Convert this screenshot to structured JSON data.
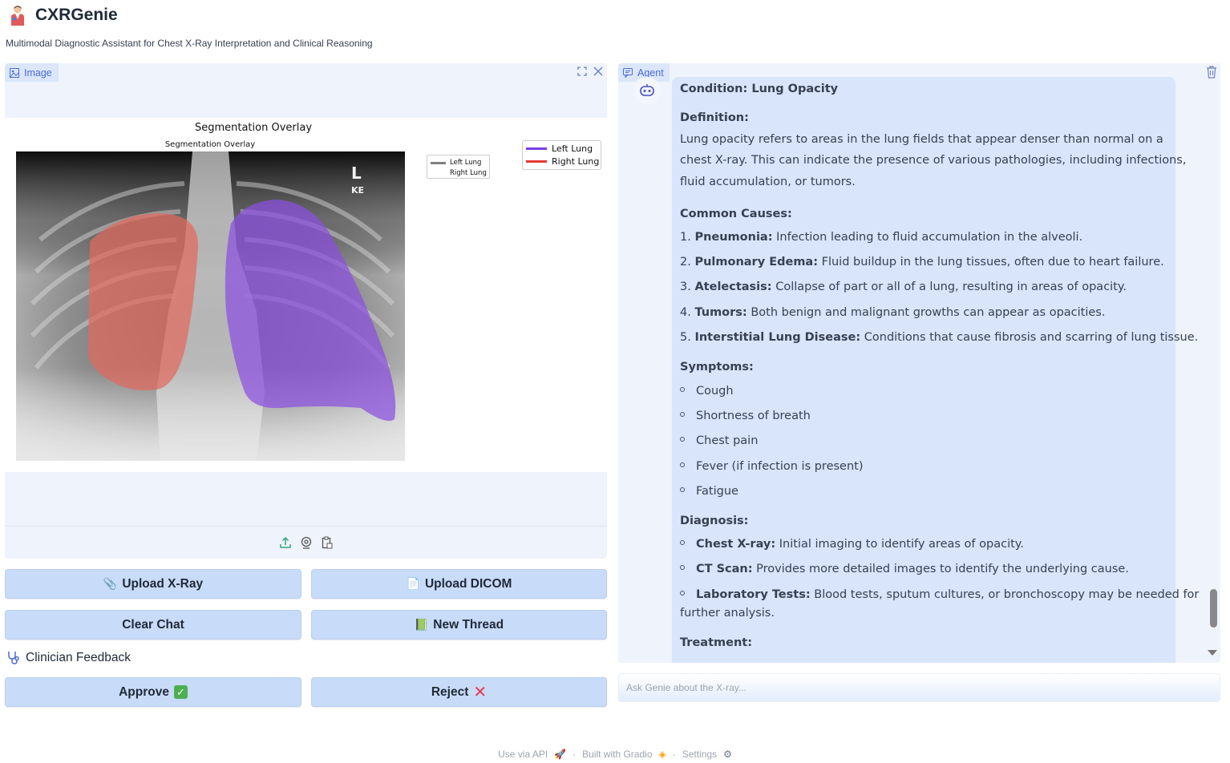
{
  "app": {
    "title": "CXRGenie",
    "subtitle": "Multimodal Diagnostic Assistant for Chest X-Ray Interpretation and Clinical Reasoning"
  },
  "image_panel": {
    "tag": "Image",
    "figure": {
      "suptitle": "Segmentation Overlay",
      "title": "Segmentation Overlay",
      "xray_markers": [
        "L",
        "KE"
      ],
      "legend_small": [
        "Left Lung",
        "Right Lung"
      ],
      "legend_big": [
        "Left Lung",
        "Right Lung"
      ],
      "colors": {
        "left_lung": "#7b3fe4",
        "right_lung": "#e53935",
        "small_legend_left": "#808080"
      }
    }
  },
  "buttons": {
    "upload_xray": "Upload X-Ray",
    "upload_dicom": "Upload DICOM",
    "clear_chat": "Clear Chat",
    "new_thread": "New Thread",
    "approve": "Approve",
    "reject": "Reject"
  },
  "feedback": {
    "label": "Clinician Feedback"
  },
  "chat": {
    "tag": "Agent",
    "condition_label": "Condition:",
    "condition_value": "Lung Opacity",
    "definition_label": "Definition:",
    "definition_lines": [
      "Lung opacity refers to areas in the lung fields that appear denser than normal on a",
      "chest X-ray. This can indicate the presence of various pathologies, including infections,",
      "fluid accumulation, or tumors."
    ],
    "causes_label": "Common Causes:",
    "causes": [
      {
        "num": "1.",
        "term": "Pneumonia:",
        "text": "Infection leading to fluid accumulation in the alveoli."
      },
      {
        "num": "2.",
        "term": "Pulmonary Edema:",
        "text": "Fluid buildup in the lung tissues, often due to heart failure."
      },
      {
        "num": "3.",
        "term": "Atelectasis:",
        "text": "Collapse of part or all of a lung, resulting in areas of opacity."
      },
      {
        "num": "4.",
        "term": "Tumors:",
        "text": "Both benign and malignant growths can appear as opacities."
      },
      {
        "num": "5.",
        "term": "Interstitial Lung Disease:",
        "text": "Conditions that cause fibrosis and scarring of lung tissue."
      }
    ],
    "symptoms_label": "Symptoms:",
    "symptoms": [
      "Cough",
      "Shortness of breath",
      "Chest pain",
      "Fever (if infection is present)",
      "Fatigue"
    ],
    "diagnosis_label": "Diagnosis:",
    "diagnosis": [
      {
        "term": "Chest X-ray:",
        "text": "Initial imaging to identify areas of opacity."
      },
      {
        "term": "CT Scan:",
        "text": "Provides more detailed images to identify the underlying cause."
      },
      {
        "term": "Laboratory Tests:",
        "text": "Blood tests, sputum cultures, or bronchoscopy may be needed for"
      }
    ],
    "diagnosis_continuation": "further analysis.",
    "treatment_label": "Treatment:",
    "input_placeholder": "Ask Genie about the X-ray..."
  },
  "footer": {
    "api": "Use via API",
    "built": "Built with Gradio",
    "settings": "Settings"
  }
}
